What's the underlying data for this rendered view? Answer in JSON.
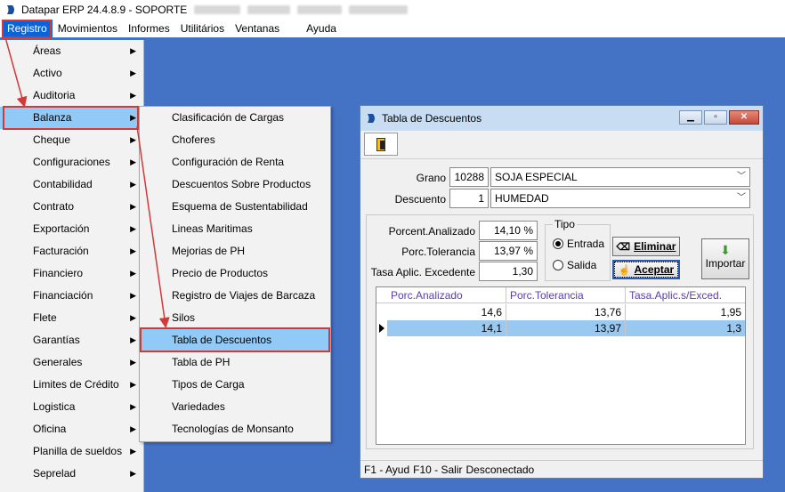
{
  "app": {
    "title": "Datapar ERP 24.4.8.9 - SOPORTE"
  },
  "menubar": [
    "Registro",
    "Movimientos",
    "Informes",
    "Utilitários",
    "Ventanas",
    "Ayuda"
  ],
  "menu_registro": [
    "Áreas",
    "Activo",
    "Auditoria",
    "Balanza",
    "Cheque",
    "Configuraciones",
    "Contabilidad",
    "Contrato",
    "Exportación",
    "Facturación",
    "Financiero",
    "Financiación",
    "Flete",
    "Garantías",
    "Generales",
    "Limites de Crédito",
    "Logistica",
    "Oficina",
    "Planilla de sueldos",
    "Seprelad"
  ],
  "menu_balanza": [
    "Clasificación de Cargas",
    "Choferes",
    "Configuración de Renta",
    "Descuentos Sobre Productos",
    "Esquema de Sustentabilidad",
    "Lineas Maritimas",
    "Mejorias de PH",
    "Precio de Productos",
    "Registro de Viajes de Barcaza",
    "Silos",
    "Tabla de Descuentos",
    "Tabla de PH",
    "Tipos de Carga",
    "Variedades",
    "Tecnologías de Monsanto"
  ],
  "window": {
    "title": "Tabla de Descuentos",
    "grano_label": "Grano",
    "grano_code": "10288",
    "grano_name": "SOJA ESPECIAL",
    "descuento_label": "Descuento",
    "descuento_code": "1",
    "descuento_name": "HUMEDAD",
    "porc_analizado_label": "Porcent.Analizado",
    "porc_analizado_value": "14,10 %",
    "porc_tolerancia_label": "Porc.Tolerancia",
    "porc_tolerancia_value": "13,97 %",
    "tasa_label": "Tasa Aplic. Excedente",
    "tasa_value": "1,30",
    "tipo_label": "Tipo",
    "entrada_label": "Entrada",
    "salida_label": "Salida",
    "tipo_selected": "Entrada",
    "eliminar_label": "Eliminar",
    "aceptar_label": "Aceptar",
    "importar_label": "Importar",
    "grid": {
      "columns": [
        "Porc.Analizado",
        "Porc.Tolerancia",
        "Tasa.Aplic.s/Exced."
      ],
      "rows": [
        [
          "14,6",
          "13,76",
          "1,95"
        ],
        [
          "14,1",
          "13,97",
          "1,3"
        ]
      ]
    },
    "status": [
      "F1 - Ayud",
      "F10 - Salir",
      "Desconectado"
    ]
  },
  "colors": {
    "desktop": "#4472c4",
    "menu_highlight": "#91c9f7",
    "annotation_red": "#d23a3a"
  },
  "icons": [
    "datapar-logo-icon",
    "exit-door-icon",
    "eraser-icon",
    "hand-accept-icon",
    "download-arrow-icon",
    "submenu-arrow-icon",
    "row-indicator-icon"
  ]
}
